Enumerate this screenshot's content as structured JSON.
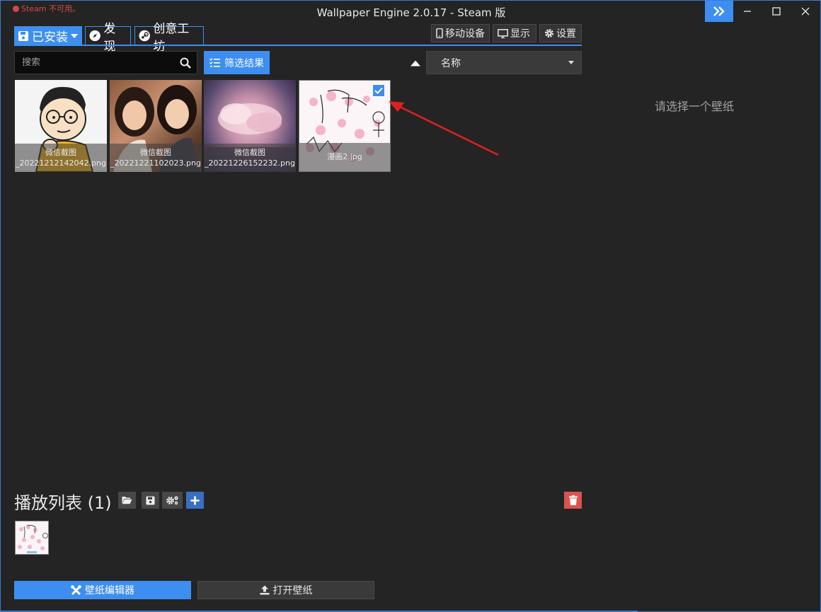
{
  "title_bar": {
    "steam_warning": "Steam 不可用。",
    "app_title": "Wallpaper Engine 2.0.17 - Steam 版",
    "icons": [
      "expand-icon",
      "minimize-icon",
      "maximize-icon",
      "close-icon"
    ]
  },
  "tabs": {
    "installed": "已安装",
    "discover": "发现",
    "workshop": "创意工坊"
  },
  "top_buttons": {
    "mobile": "移动设备",
    "display": "显示",
    "settings": "设置"
  },
  "search": {
    "placeholder": "搜索",
    "value": ""
  },
  "filter": {
    "label": "筛选结果"
  },
  "sort": {
    "selected": "名称",
    "direction": "ascending"
  },
  "wallpapers": [
    {
      "caption_line1": "微信截图",
      "caption_line2": "_20221212142042.png",
      "selected": false
    },
    {
      "caption_line1": "微信截图",
      "caption_line2": "_20221221102023.png",
      "selected": false
    },
    {
      "caption_line1": "微信截图",
      "caption_line2": "_20221226152232.png",
      "selected": false
    },
    {
      "caption_line1": "",
      "caption_line2": "漫画2.jpg",
      "selected": true
    }
  ],
  "details_panel": {
    "empty_text": "请选择一个壁纸"
  },
  "playlist": {
    "title": "播放列表 (1)"
  },
  "bottom_buttons": {
    "editor": "壁纸编辑器",
    "open": "打开壁纸"
  },
  "colors": {
    "accent": "#3d8ef0",
    "background": "#242424",
    "danger": "#d9534f",
    "annotation_arrow": "#e02020"
  }
}
